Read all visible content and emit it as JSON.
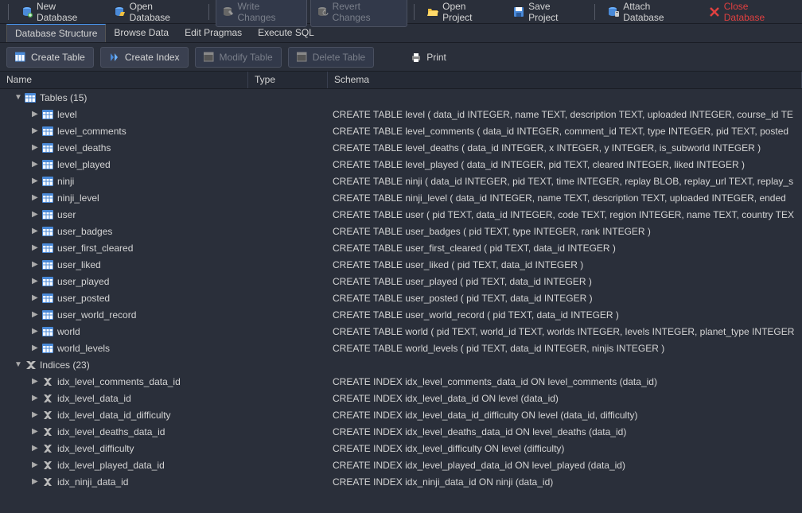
{
  "toolbar": {
    "new_database": "New Database",
    "open_database": "Open Database",
    "write_changes": "Write Changes",
    "revert_changes": "Revert Changes",
    "open_project": "Open Project",
    "save_project": "Save Project",
    "attach_database": "Attach Database",
    "close_database": "Close Database"
  },
  "tabs": {
    "database_structure": "Database Structure",
    "browse_data": "Browse Data",
    "edit_pragmas": "Edit Pragmas",
    "execute_sql": "Execute SQL"
  },
  "subtoolbar": {
    "create_table": "Create Table",
    "create_index": "Create Index",
    "modify_table": "Modify Table",
    "delete_table": "Delete Table",
    "print": "Print"
  },
  "columns": {
    "name": "Name",
    "type": "Type",
    "schema": "Schema"
  },
  "root_tables": "Tables (15)",
  "root_indices": "Indices (23)",
  "tables": [
    {
      "name": "level",
      "schema": "CREATE TABLE level ( data_id INTEGER, name TEXT, description TEXT, uploaded INTEGER, course_id TE"
    },
    {
      "name": "level_comments",
      "schema": "CREATE TABLE level_comments ( data_id INTEGER, comment_id TEXT, type INTEGER, pid TEXT, posted"
    },
    {
      "name": "level_deaths",
      "schema": "CREATE TABLE level_deaths ( data_id INTEGER, x INTEGER, y INTEGER, is_subworld INTEGER )"
    },
    {
      "name": "level_played",
      "schema": "CREATE TABLE level_played ( data_id INTEGER, pid TEXT, cleared INTEGER, liked INTEGER )"
    },
    {
      "name": "ninji",
      "schema": "CREATE TABLE ninji ( data_id INTEGER, pid TEXT, time INTEGER, replay BLOB, replay_url TEXT, replay_s"
    },
    {
      "name": "ninji_level",
      "schema": "CREATE TABLE ninji_level ( data_id INTEGER, name TEXT, description TEXT, uploaded INTEGER, ended"
    },
    {
      "name": "user",
      "schema": "CREATE TABLE user ( pid TEXT, data_id INTEGER, code TEXT, region INTEGER, name TEXT, country TEX"
    },
    {
      "name": "user_badges",
      "schema": "CREATE TABLE user_badges ( pid TEXT, type INTEGER, rank INTEGER )"
    },
    {
      "name": "user_first_cleared",
      "schema": "CREATE TABLE user_first_cleared ( pid TEXT, data_id INTEGER )"
    },
    {
      "name": "user_liked",
      "schema": "CREATE TABLE user_liked ( pid TEXT, data_id INTEGER )"
    },
    {
      "name": "user_played",
      "schema": "CREATE TABLE user_played ( pid TEXT, data_id INTEGER )"
    },
    {
      "name": "user_posted",
      "schema": "CREATE TABLE user_posted ( pid TEXT, data_id INTEGER )"
    },
    {
      "name": "user_world_record",
      "schema": "CREATE TABLE user_world_record ( pid TEXT, data_id INTEGER )"
    },
    {
      "name": "world",
      "schema": "CREATE TABLE world ( pid TEXT, world_id TEXT, worlds INTEGER, levels INTEGER, planet_type INTEGER"
    },
    {
      "name": "world_levels",
      "schema": "CREATE TABLE world_levels ( pid TEXT, data_id INTEGER, ninjis INTEGER )"
    }
  ],
  "indices": [
    {
      "name": "idx_level_comments_data_id",
      "schema": "CREATE INDEX idx_level_comments_data_id ON level_comments (data_id)"
    },
    {
      "name": "idx_level_data_id",
      "schema": "CREATE INDEX idx_level_data_id ON level (data_id)"
    },
    {
      "name": "idx_level_data_id_difficulty",
      "schema": "CREATE INDEX idx_level_data_id_difficulty ON level (data_id, difficulty)"
    },
    {
      "name": "idx_level_deaths_data_id",
      "schema": "CREATE INDEX idx_level_deaths_data_id ON level_deaths (data_id)"
    },
    {
      "name": "idx_level_difficulty",
      "schema": "CREATE INDEX idx_level_difficulty ON level (difficulty)"
    },
    {
      "name": "idx_level_played_data_id",
      "schema": "CREATE INDEX idx_level_played_data_id ON level_played (data_id)"
    },
    {
      "name": "idx_ninji_data_id",
      "schema": "CREATE INDEX idx_ninji_data_id ON ninji (data_id)"
    }
  ]
}
